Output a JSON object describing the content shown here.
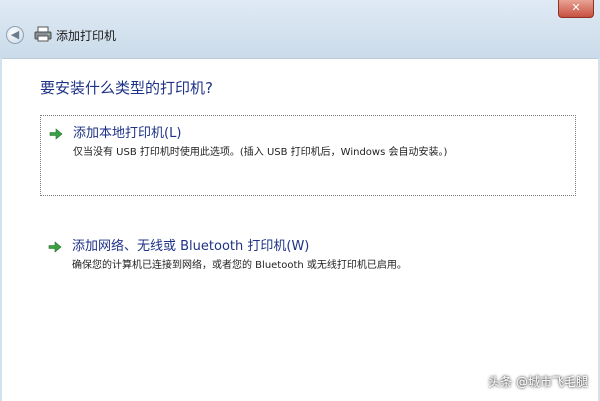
{
  "window": {
    "title": "添加打印机",
    "close_label": "✕",
    "back_label": "◀"
  },
  "main": {
    "heading": "要安装什么类型的打印机?",
    "options": [
      {
        "title": "添加本地打印机(L)",
        "description": "仅当没有 USB 打印机时使用此选项。(插入 USB 打印机后，Windows 会自动安装。)"
      },
      {
        "title": "添加网络、无线或 Bluetooth 打印机(W)",
        "description": "确保您的计算机已连接到网络，或者您的 Bluetooth 或无线打印机已启用。"
      }
    ]
  },
  "watermark": "头条 @城市飞毛腿",
  "colors": {
    "heading": "#1e3287",
    "arrow": "#3aa142",
    "close": "#c75040"
  }
}
